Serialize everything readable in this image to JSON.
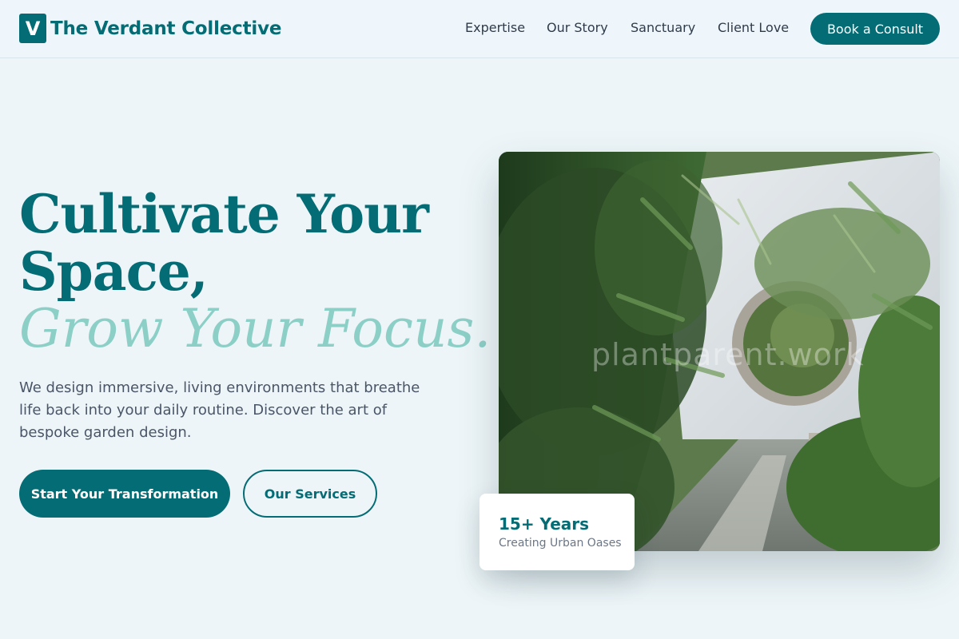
{
  "header": {
    "logo_letter": "V",
    "brand_name": "The Verdant Collective",
    "nav": [
      {
        "label": "Expertise"
      },
      {
        "label": "Our Story"
      },
      {
        "label": "Sanctuary"
      },
      {
        "label": "Client Love"
      }
    ],
    "cta_label": "Book a Consult"
  },
  "hero": {
    "headline_line1": "Cultivate Your",
    "headline_line2": "Space,",
    "headline_accent": "Grow Your Focus.",
    "lead": "We design immersive, living environments that breathe life back into your daily routine. Discover the art of bespoke garden design.",
    "primary_button": "Start Your Transformation",
    "secondary_button": "Our Services"
  },
  "image": {
    "watermark": "plantparent.work",
    "stat_value": "15+ Years",
    "stat_caption": "Creating Urban Oases"
  },
  "colors": {
    "brand": "#046c74",
    "accent": "#8ccfc6",
    "background": "#edf5f8"
  }
}
